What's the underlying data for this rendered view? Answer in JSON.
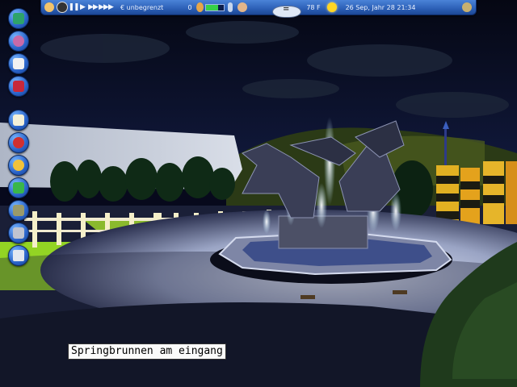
{
  "toolbar": {
    "funds": "€ unbegrenzt",
    "guests": "0",
    "money_level": 0.7,
    "temperature": "78 F",
    "date_time": "26 Sep, Jahr 28  21:34",
    "ground_tab_label": "="
  },
  "controls": {
    "pause": "❚❚",
    "play": "▶",
    "fast": "▶▶",
    "fastest": "▶▶▶"
  },
  "left_toolbar": [
    {
      "name": "park-map-icon"
    },
    {
      "name": "guests-icon"
    },
    {
      "name": "cards-icon"
    },
    {
      "name": "scenery-book-icon"
    },
    {
      "name": "messages-icon"
    },
    {
      "name": "research-icon"
    },
    {
      "name": "staff-icon"
    },
    {
      "name": "paths-icon"
    },
    {
      "name": "terrain-icon"
    },
    {
      "name": "tools-icon"
    },
    {
      "name": "trash-icon"
    }
  ],
  "caption": "Springbrunnen am eingang",
  "colors": {
    "sky": "#07091c",
    "toolbar": "#2c5fb6",
    "grass": "#9cdc26",
    "fountain_light": "#e8f6ff"
  }
}
